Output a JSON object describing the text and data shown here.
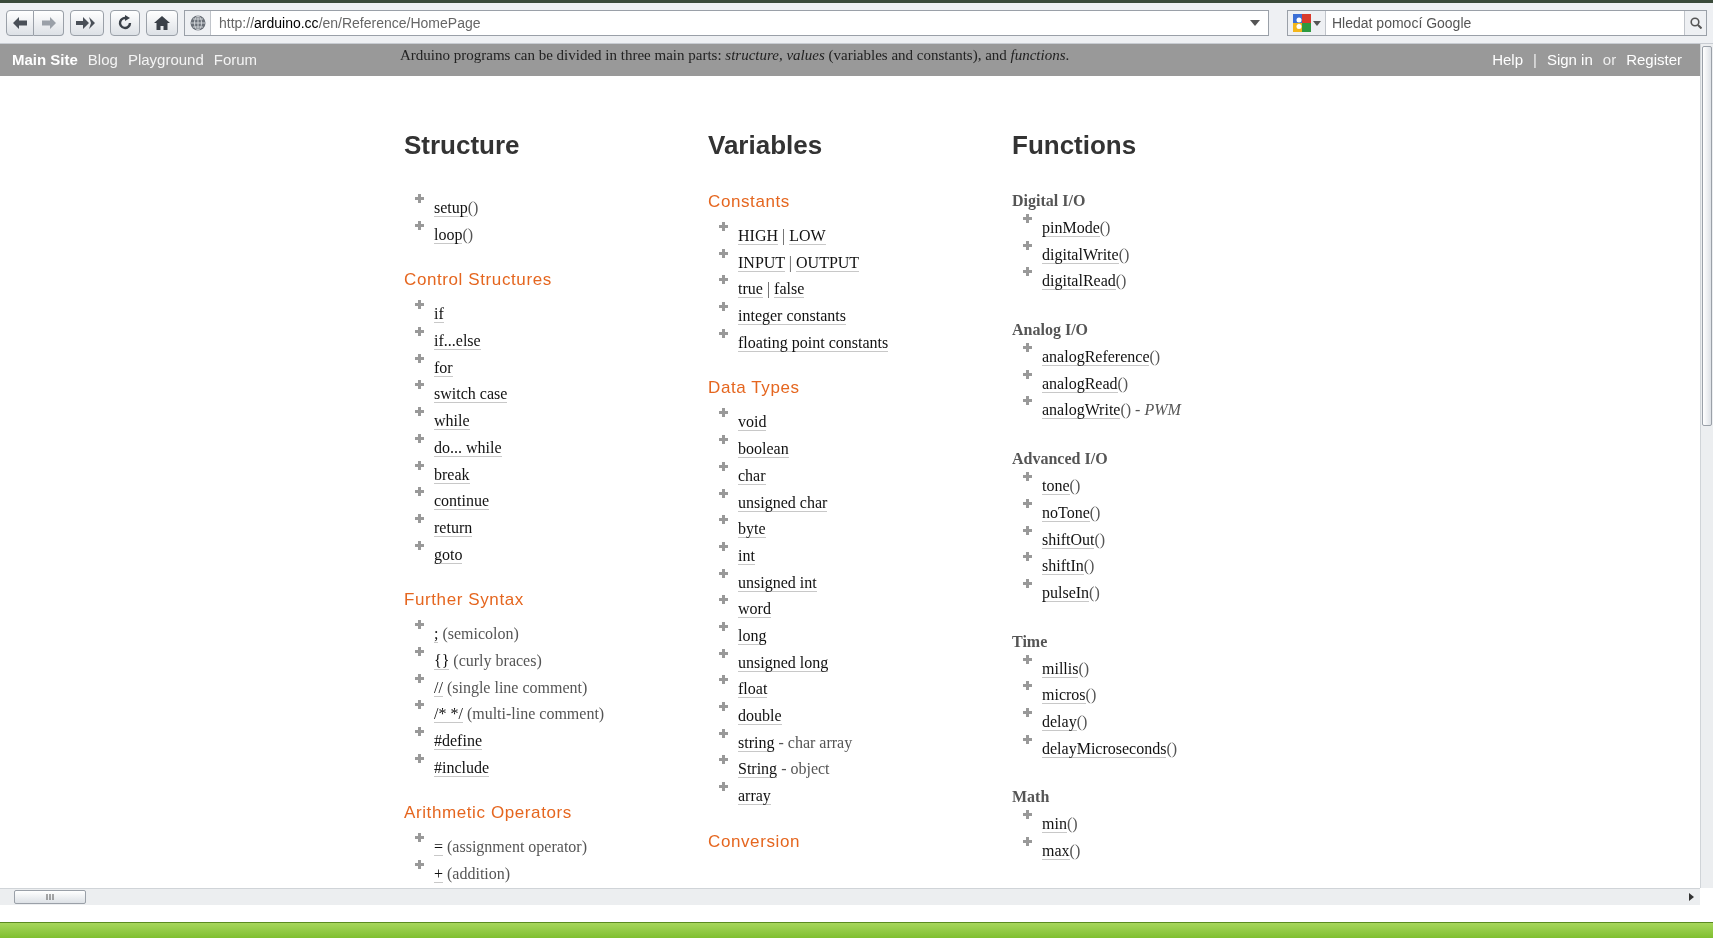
{
  "toolbar": {
    "url_prefix": "http://",
    "url_host": "arduino.cc",
    "url_path": "/en/Reference/HomePage",
    "search_placeholder": "Hledat pomocí Google"
  },
  "nav": {
    "left": [
      {
        "label": "Main Site",
        "selected": true
      },
      {
        "label": "Blog",
        "selected": false
      },
      {
        "label": "Playground",
        "selected": false
      },
      {
        "label": "Forum",
        "selected": false
      }
    ],
    "intro": "Arduino programs can be divided in three main parts: *structure*, *values* (variables and constants), and *functions*.",
    "right": [
      {
        "text": "Help",
        "kind": "link"
      },
      {
        "text": "|",
        "kind": "separator"
      },
      {
        "text": "Sign in",
        "kind": "link"
      },
      {
        "text": "or",
        "kind": "separator"
      },
      {
        "text": "Register",
        "kind": "link"
      }
    ]
  },
  "columns": [
    {
      "title": "Structure",
      "sections": [
        {
          "items": [
            [
              {
                "text": "setup",
                "kind": "link"
              },
              {
                "text": "()",
                "kind": "plain"
              }
            ],
            [
              {
                "text": "loop",
                "kind": "link"
              },
              {
                "text": "()",
                "kind": "plain"
              }
            ]
          ]
        },
        {
          "heading": "Control Structures",
          "kind": "category",
          "items": [
            [
              {
                "text": "if",
                "kind": "link"
              }
            ],
            [
              {
                "text": "if...else",
                "kind": "link"
              }
            ],
            [
              {
                "text": "for",
                "kind": "link"
              }
            ],
            [
              {
                "text": "switch case",
                "kind": "link"
              }
            ],
            [
              {
                "text": "while",
                "kind": "link"
              }
            ],
            [
              {
                "text": "do... while",
                "kind": "link"
              }
            ],
            [
              {
                "text": "break",
                "kind": "link"
              }
            ],
            [
              {
                "text": "continue",
                "kind": "link"
              }
            ],
            [
              {
                "text": "return",
                "kind": "link"
              }
            ],
            [
              {
                "text": "goto",
                "kind": "link"
              }
            ]
          ]
        },
        {
          "heading": "Further Syntax",
          "kind": "category",
          "items": [
            [
              {
                "text": ";",
                "kind": "link"
              },
              {
                "text": " (semicolon)",
                "kind": "plain"
              }
            ],
            [
              {
                "text": "{}",
                "kind": "link"
              },
              {
                "text": " (curly braces)",
                "kind": "plain"
              }
            ],
            [
              {
                "text": "//",
                "kind": "link"
              },
              {
                "text": " (single line comment)",
                "kind": "plain"
              }
            ],
            [
              {
                "text": "/* */",
                "kind": "link"
              },
              {
                "text": " (multi-line comment)",
                "kind": "plain"
              }
            ],
            [
              {
                "text": "#define",
                "kind": "link"
              }
            ],
            [
              {
                "text": "#include",
                "kind": "link"
              }
            ]
          ]
        },
        {
          "heading": "Arithmetic Operators",
          "kind": "category",
          "items": [
            [
              {
                "text": "=",
                "kind": "link"
              },
              {
                "text": " (assignment operator)",
                "kind": "plain"
              }
            ],
            [
              {
                "text": "+",
                "kind": "link"
              },
              {
                "text": " (addition)",
                "kind": "plain"
              }
            ]
          ]
        }
      ]
    },
    {
      "title": "Variables",
      "sections": [
        {
          "heading": "Constants",
          "kind": "category",
          "items": [
            [
              {
                "text": "HIGH",
                "kind": "link"
              },
              {
                "text": " | ",
                "kind": "plain"
              },
              {
                "text": "LOW",
                "kind": "link"
              }
            ],
            [
              {
                "text": "INPUT",
                "kind": "link"
              },
              {
                "text": " | ",
                "kind": "plain"
              },
              {
                "text": "OUTPUT",
                "kind": "link"
              }
            ],
            [
              {
                "text": "true",
                "kind": "link"
              },
              {
                "text": " | ",
                "kind": "plain"
              },
              {
                "text": "false",
                "kind": "link"
              }
            ],
            [
              {
                "text": "integer constants",
                "kind": "link"
              }
            ],
            [
              {
                "text": "floating point constants",
                "kind": "link"
              }
            ]
          ]
        },
        {
          "heading": "Data Types",
          "kind": "category",
          "items": [
            [
              {
                "text": "void",
                "kind": "link"
              }
            ],
            [
              {
                "text": "boolean",
                "kind": "link"
              }
            ],
            [
              {
                "text": "char",
                "kind": "link"
              }
            ],
            [
              {
                "text": "unsigned char",
                "kind": "link"
              }
            ],
            [
              {
                "text": "byte",
                "kind": "link"
              }
            ],
            [
              {
                "text": "int",
                "kind": "link"
              }
            ],
            [
              {
                "text": "unsigned int",
                "kind": "link"
              }
            ],
            [
              {
                "text": "word",
                "kind": "link"
              }
            ],
            [
              {
                "text": "long",
                "kind": "link"
              }
            ],
            [
              {
                "text": "unsigned long",
                "kind": "link"
              }
            ],
            [
              {
                "text": "float",
                "kind": "link"
              }
            ],
            [
              {
                "text": "double",
                "kind": "link"
              }
            ],
            [
              {
                "text": "string",
                "kind": "link"
              },
              {
                "text": " - char array",
                "kind": "plain"
              }
            ],
            [
              {
                "text": "String",
                "kind": "link"
              },
              {
                "text": " - object",
                "kind": "plain"
              }
            ],
            [
              {
                "text": "array",
                "kind": "link"
              }
            ]
          ]
        },
        {
          "heading": "Conversion",
          "kind": "category"
        }
      ]
    },
    {
      "title": "Functions",
      "sections": [
        {
          "heading": "Digital I/O",
          "kind": "group",
          "items": [
            [
              {
                "text": "pinMode",
                "kind": "link"
              },
              {
                "text": "()",
                "kind": "plain"
              }
            ],
            [
              {
                "text": "digitalWrite",
                "kind": "link"
              },
              {
                "text": "()",
                "kind": "plain"
              }
            ],
            [
              {
                "text": "digitalRead",
                "kind": "link"
              },
              {
                "text": "()",
                "kind": "plain"
              }
            ]
          ]
        },
        {
          "heading": "Analog I/O",
          "kind": "group",
          "items": [
            [
              {
                "text": "analogReference",
                "kind": "link"
              },
              {
                "text": "()",
                "kind": "plain"
              }
            ],
            [
              {
                "text": "analogRead",
                "kind": "link"
              },
              {
                "text": "()",
                "kind": "plain"
              }
            ],
            [
              {
                "text": "analogWrite",
                "kind": "link"
              },
              {
                "text": "() - *PWM*",
                "kind": "plain"
              }
            ]
          ]
        },
        {
          "heading": "Advanced I/O",
          "kind": "group",
          "items": [
            [
              {
                "text": "tone",
                "kind": "link"
              },
              {
                "text": "()",
                "kind": "plain"
              }
            ],
            [
              {
                "text": "noTone",
                "kind": "link"
              },
              {
                "text": "()",
                "kind": "plain"
              }
            ],
            [
              {
                "text": "shiftOut",
                "kind": "link"
              },
              {
                "text": "()",
                "kind": "plain"
              }
            ],
            [
              {
                "text": "shiftIn",
                "kind": "link"
              },
              {
                "text": "()",
                "kind": "plain"
              }
            ],
            [
              {
                "text": "pulseIn",
                "kind": "link"
              },
              {
                "text": "()",
                "kind": "plain"
              }
            ]
          ]
        },
        {
          "heading": "Time",
          "kind": "group",
          "items": [
            [
              {
                "text": "millis",
                "kind": "link"
              },
              {
                "text": "()",
                "kind": "plain"
              }
            ],
            [
              {
                "text": "micros",
                "kind": "link"
              },
              {
                "text": "()",
                "kind": "plain"
              }
            ],
            [
              {
                "text": "delay",
                "kind": "link"
              },
              {
                "text": "()",
                "kind": "plain"
              }
            ],
            [
              {
                "text": "delayMicroseconds",
                "kind": "link"
              },
              {
                "text": "()",
                "kind": "plain"
              }
            ]
          ]
        },
        {
          "heading": "Math",
          "kind": "group",
          "items": [
            [
              {
                "text": "min",
                "kind": "link"
              },
              {
                "text": "()",
                "kind": "plain"
              }
            ],
            [
              {
                "text": "max",
                "kind": "link"
              },
              {
                "text": "()",
                "kind": "plain"
              }
            ]
          ]
        }
      ]
    }
  ]
}
